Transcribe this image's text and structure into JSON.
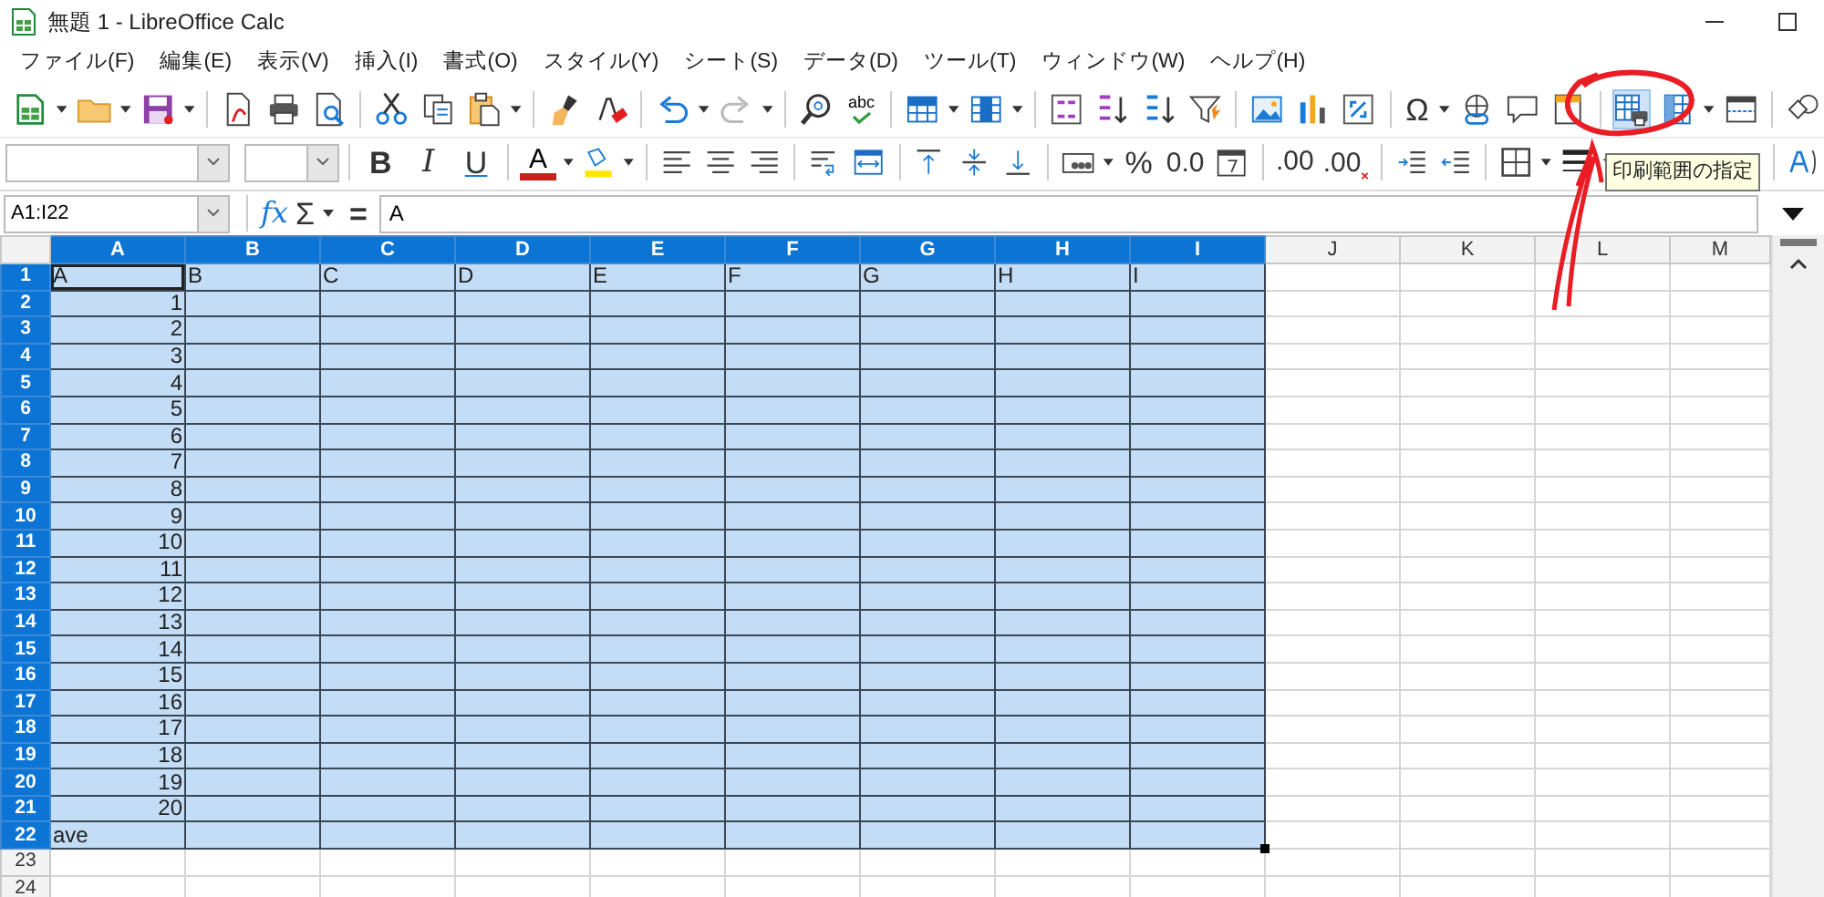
{
  "window": {
    "title": "無題 1 - LibreOffice Calc"
  },
  "menu": [
    {
      "label": "ファイル(F)"
    },
    {
      "label": "編集(E)"
    },
    {
      "label": "表示(V)"
    },
    {
      "label": "挿入(I)"
    },
    {
      "label": "書式(O)"
    },
    {
      "label": "スタイル(Y)"
    },
    {
      "label": "シート(S)"
    },
    {
      "label": "データ(D)"
    },
    {
      "label": "ツール(T)"
    },
    {
      "label": "ウィンドウ(W)"
    },
    {
      "label": "ヘルプ(H)"
    }
  ],
  "standard_toolbar": {
    "spellcheck": "abc",
    "special_character": "Ω",
    "print_range_highlighted": true
  },
  "formatting_toolbar": {
    "bold": "B",
    "italic": "I",
    "underline": "U",
    "font_color": "A",
    "percent": "%",
    "standard_format": "0.0",
    "add_decimal": ".00",
    "delete_decimal": ".00"
  },
  "formula_bar": {
    "name_box": "A1:I22",
    "function_wizard": "fx",
    "sum": "Σ",
    "equals": "=",
    "content": "A"
  },
  "tooltip": "印刷範囲の指定",
  "sheet": {
    "columns": [
      {
        "label": "A",
        "selected": true
      },
      {
        "label": "B",
        "selected": true
      },
      {
        "label": "C",
        "selected": true
      },
      {
        "label": "D",
        "selected": true
      },
      {
        "label": "E",
        "selected": true
      },
      {
        "label": "F",
        "selected": true
      },
      {
        "label": "G",
        "selected": true
      },
      {
        "label": "H",
        "selected": true
      },
      {
        "label": "I",
        "selected": true
      },
      {
        "label": "J",
        "selected": false
      },
      {
        "label": "K",
        "selected": false
      },
      {
        "label": "L",
        "selected": false
      },
      {
        "label": "M",
        "selected": false
      }
    ],
    "rows": [
      {
        "label": "1",
        "selected": true,
        "cells": [
          {
            "text": "A",
            "kind": "text",
            "cursor": true
          },
          {
            "text": "B",
            "kind": "text",
            "cursor": false
          },
          {
            "text": "C",
            "kind": "text",
            "cursor": false
          },
          {
            "text": "D",
            "kind": "text",
            "cursor": false
          },
          {
            "text": "E",
            "kind": "text",
            "cursor": false
          },
          {
            "text": "F",
            "kind": "text",
            "cursor": false
          },
          {
            "text": "G",
            "kind": "text",
            "cursor": false
          },
          {
            "text": "H",
            "kind": "text",
            "cursor": false
          },
          {
            "text": "I",
            "kind": "text",
            "cursor": false
          }
        ]
      },
      {
        "label": "2",
        "selected": true,
        "cells": [
          {
            "text": "1",
            "kind": "number",
            "cursor": false
          }
        ]
      },
      {
        "label": "3",
        "selected": true,
        "cells": [
          {
            "text": "2",
            "kind": "number",
            "cursor": false
          }
        ]
      },
      {
        "label": "4",
        "selected": true,
        "cells": [
          {
            "text": "3",
            "kind": "number",
            "cursor": false
          }
        ]
      },
      {
        "label": "5",
        "selected": true,
        "cells": [
          {
            "text": "4",
            "kind": "number",
            "cursor": false
          }
        ]
      },
      {
        "label": "6",
        "selected": true,
        "cells": [
          {
            "text": "5",
            "kind": "number",
            "cursor": false
          }
        ]
      },
      {
        "label": "7",
        "selected": true,
        "cells": [
          {
            "text": "6",
            "kind": "number",
            "cursor": false
          }
        ]
      },
      {
        "label": "8",
        "selected": true,
        "cells": [
          {
            "text": "7",
            "kind": "number",
            "cursor": false
          }
        ]
      },
      {
        "label": "9",
        "selected": true,
        "cells": [
          {
            "text": "8",
            "kind": "number",
            "cursor": false
          }
        ]
      },
      {
        "label": "10",
        "selected": true,
        "cells": [
          {
            "text": "9",
            "kind": "number",
            "cursor": false
          }
        ]
      },
      {
        "label": "11",
        "selected": true,
        "cells": [
          {
            "text": "10",
            "kind": "number",
            "cursor": false
          }
        ]
      },
      {
        "label": "12",
        "selected": true,
        "cells": [
          {
            "text": "11",
            "kind": "number",
            "cursor": false
          }
        ]
      },
      {
        "label": "13",
        "selected": true,
        "cells": [
          {
            "text": "12",
            "kind": "number",
            "cursor": false
          }
        ]
      },
      {
        "label": "14",
        "selected": true,
        "cells": [
          {
            "text": "13",
            "kind": "number",
            "cursor": false
          }
        ]
      },
      {
        "label": "15",
        "selected": true,
        "cells": [
          {
            "text": "14",
            "kind": "number",
            "cursor": false
          }
        ]
      },
      {
        "label": "16",
        "selected": true,
        "cells": [
          {
            "text": "15",
            "kind": "number",
            "cursor": false
          }
        ]
      },
      {
        "label": "17",
        "selected": true,
        "cells": [
          {
            "text": "16",
            "kind": "number",
            "cursor": false
          }
        ]
      },
      {
        "label": "18",
        "selected": true,
        "cells": [
          {
            "text": "17",
            "kind": "number",
            "cursor": false
          }
        ]
      },
      {
        "label": "19",
        "selected": true,
        "cells": [
          {
            "text": "18",
            "kind": "number",
            "cursor": false
          }
        ]
      },
      {
        "label": "20",
        "selected": true,
        "cells": [
          {
            "text": "19",
            "kind": "number",
            "cursor": false
          }
        ]
      },
      {
        "label": "21",
        "selected": true,
        "cells": [
          {
            "text": "20",
            "kind": "number",
            "cursor": false
          }
        ]
      },
      {
        "label": "22",
        "selected": true,
        "cells": [
          {
            "text": "ave",
            "kind": "text",
            "cursor": false
          }
        ]
      },
      {
        "label": "23",
        "selected": false,
        "cells": []
      },
      {
        "label": "24",
        "selected": false,
        "cells": []
      }
    ]
  },
  "annotations": {
    "circle": true,
    "arrow": true
  }
}
